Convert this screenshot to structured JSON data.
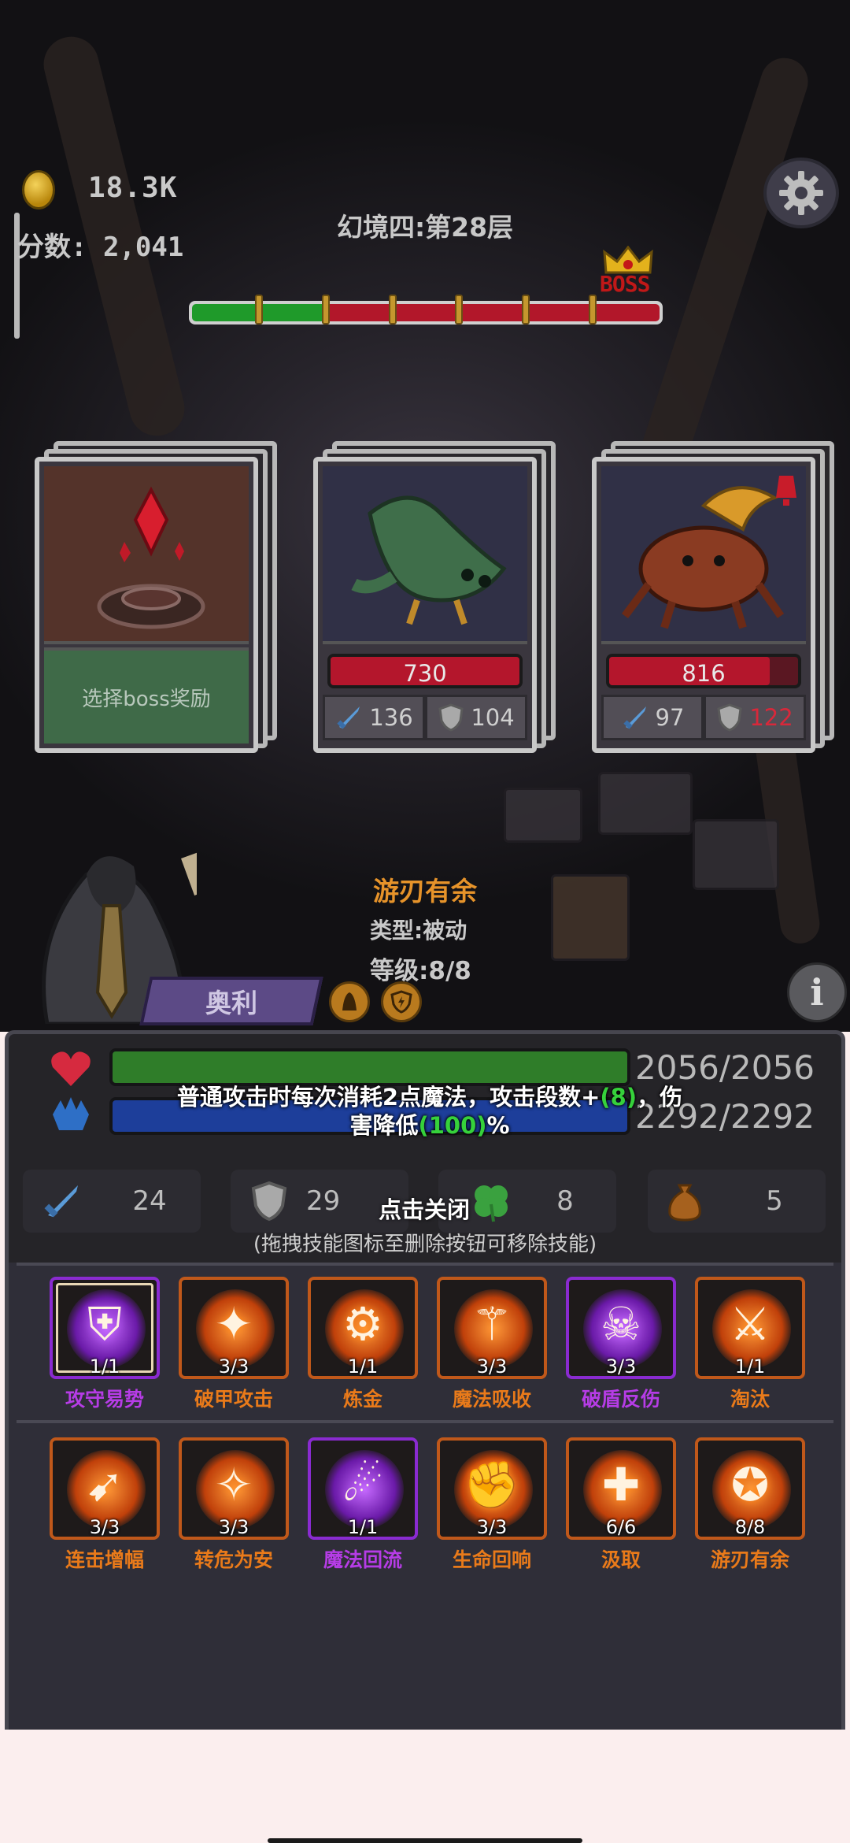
{
  "hud": {
    "gold": "18.3K",
    "score": "分数: 2,041",
    "floor_title": "幻境四:第28层",
    "boss_label": "BOSS",
    "progress": {
      "segments_total": 7,
      "segments_cleared": 2
    }
  },
  "cards": [
    {
      "kind": "reward",
      "button_label": "选择boss奖励"
    },
    {
      "kind": "enemy",
      "name_icon": "lizard-enemy",
      "hp": "730",
      "hp_fraction": 1.0,
      "attack": "136",
      "defense": "104"
    },
    {
      "kind": "enemy",
      "name_icon": "crab-enemy",
      "hp": "816",
      "hp_fraction": 0.85,
      "attack": "97",
      "defense": "122"
    }
  ],
  "tooltip": {
    "name": "游刃有余",
    "type": "类型:被动",
    "level": "等级:8/8"
  },
  "hero": {
    "name": "奥利"
  },
  "panel": {
    "hp_text": "2056/2056",
    "mp_text": "2292/2292",
    "desc_line1_a": "普通攻击时每次消耗2点魔法，攻击段数+",
    "desc_line1_hl": "(8)",
    "desc_line1_b": "，伤",
    "desc_line2_a": "害降低",
    "desc_line2_hl": "(100)",
    "desc_line2_b": "%",
    "stats": {
      "attack": "24",
      "defense": "29",
      "luck": "8",
      "bag": "5"
    },
    "close_tip": "点击关闭",
    "drag_tip": "(拖拽技能图标至删除按钮可移除技能)"
  },
  "skills_row1": [
    {
      "label": "攻守易势",
      "count": "1/1",
      "rarity": "purple",
      "icon": "shield-icon",
      "selected": true
    },
    {
      "label": "破甲攻击",
      "count": "3/3",
      "rarity": "orange",
      "icon": "slash-icon"
    },
    {
      "label": "炼金",
      "count": "1/1",
      "rarity": "orange",
      "icon": "gear-icon"
    },
    {
      "label": "魔法吸收",
      "count": "3/3",
      "rarity": "orange",
      "icon": "caduceus-icon"
    },
    {
      "label": "破盾反伤",
      "count": "3/3",
      "rarity": "purple",
      "icon": "demon-shield-icon"
    },
    {
      "label": "淘汰",
      "count": "1/1",
      "rarity": "orange",
      "icon": "sword-slash-icon"
    }
  ],
  "skills_row2": [
    {
      "label": "连击增幅",
      "count": "3/3",
      "rarity": "orange",
      "icon": "runner-icon"
    },
    {
      "label": "转危为安",
      "count": "3/3",
      "rarity": "orange",
      "icon": "sparkle-plus-icon"
    },
    {
      "label": "魔法回流",
      "count": "1/1",
      "rarity": "purple",
      "icon": "spirit-icon"
    },
    {
      "label": "生命回响",
      "count": "3/3",
      "rarity": "orange",
      "icon": "muscle-icon"
    },
    {
      "label": "汲取",
      "count": "6/6",
      "rarity": "orange",
      "icon": "cross-shield-icon"
    },
    {
      "label": "游刃有余",
      "count": "8/8",
      "rarity": "orange",
      "icon": "blade-swirl-icon"
    }
  ]
}
